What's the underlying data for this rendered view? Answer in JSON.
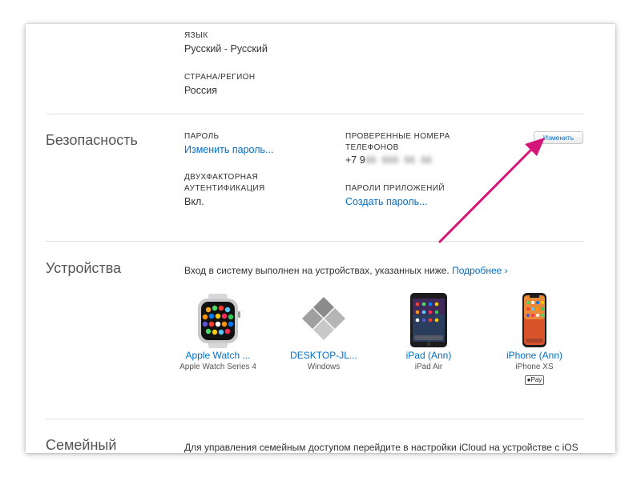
{
  "account": {
    "language_label": "ЯЗЫК",
    "language_value": "Русский - Русский",
    "country_label": "СТРАНА/РЕГИОН",
    "country_value": "Россия"
  },
  "security": {
    "title": "Безопасность",
    "password_label": "ПАРОЛЬ",
    "change_password_link": "Изменить пароль...",
    "two_factor_label_line1": "ДВУХФАКТОРНАЯ",
    "two_factor_label_line2": "АУТЕНТИФИКАЦИЯ",
    "two_factor_value": "Вкл.",
    "trusted_phones_label_line1": "ПРОВЕРЕННЫЕ НОМЕРА",
    "trusted_phones_label_line2": "ТЕЛЕФОНОВ",
    "phone_prefix": "+7 9",
    "app_passwords_label": "ПАРОЛИ ПРИЛОЖЕНИЙ",
    "create_password_link": "Создать пароль...",
    "edit_button": "Изменить"
  },
  "devices": {
    "title": "Устройства",
    "intro_text": "Вход в систему выполнен на устройствах, указанных ниже.",
    "more_link": "Подробнее ›",
    "items": [
      {
        "name": "Apple Watch ...",
        "model": "Apple Watch Series 4",
        "icon": "apple-watch-icon"
      },
      {
        "name": "DESKTOP-JL...",
        "model": "Windows",
        "icon": "windows-pc-icon"
      },
      {
        "name": "iPad (Ann)",
        "model": "iPad Air",
        "icon": "ipad-icon"
      },
      {
        "name": "iPhone (Ann)",
        "model": "iPhone XS",
        "icon": "iphone-icon",
        "badge": "Pay"
      }
    ]
  },
  "family": {
    "title": "Семейный",
    "text": "Для управления семейным доступом перейдите в настройки iCloud на устройстве с iOS"
  },
  "colors": {
    "link": "#0070c9",
    "annotation_arrow": "#d4157a"
  }
}
